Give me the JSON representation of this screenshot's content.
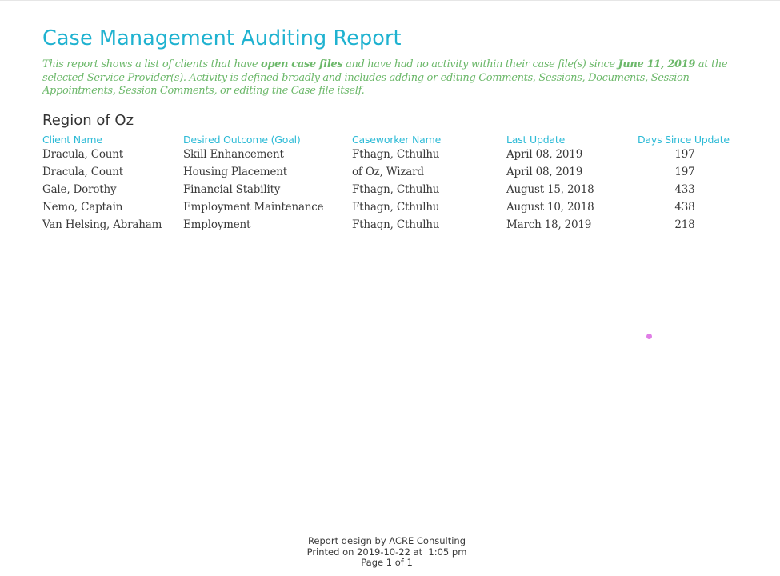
{
  "report": {
    "title": "Case Management Auditing Report",
    "intro": {
      "part1": "This report shows a list of clients that have ",
      "bold1": "open case files",
      "part2": " and have had no activity within their case file(s) since ",
      "bold2": "June 11, 2019",
      "part3": " at the selected Service Provider(s). Activity is defined broadly and includes adding or editing Comments, Sessions, Documents, Session Appointments, Session Comments, or editing the Case file itself."
    },
    "colors": {
      "title": "#1fb2d0",
      "intro": "#6cb86a",
      "header": "#2cbad6",
      "body_text": "#3a3a3a"
    }
  },
  "region": {
    "name": "Region of Oz",
    "columns": [
      "Client Name",
      "Desired Outcome (Goal)",
      "Caseworker Name",
      "Last Update",
      "Days Since Update"
    ],
    "rows": [
      [
        "Dracula, Count",
        "Skill Enhancement",
        "Fthagn, Cthulhu",
        "April 08, 2019",
        "197"
      ],
      [
        "Dracula, Count",
        "Housing Placement",
        "of Oz, Wizard",
        "April 08, 2019",
        "197"
      ],
      [
        "Gale, Dorothy",
        "Financial Stability",
        "Fthagn, Cthulhu",
        "August 15, 2018",
        "433"
      ],
      [
        "Nemo, Captain",
        "Employment Maintenance",
        "Fthagn, Cthulhu",
        "August 10, 2018",
        "438"
      ],
      [
        "Van Helsing, Abraham",
        "Employment",
        "Fthagn, Cthulhu",
        "March 18, 2019",
        "218"
      ]
    ]
  },
  "footer": {
    "design_credit": "Report design by ACRE Consulting",
    "printed": "Printed on 2019-10-22 at  1:05 pm",
    "page": "Page 1 of 1"
  }
}
